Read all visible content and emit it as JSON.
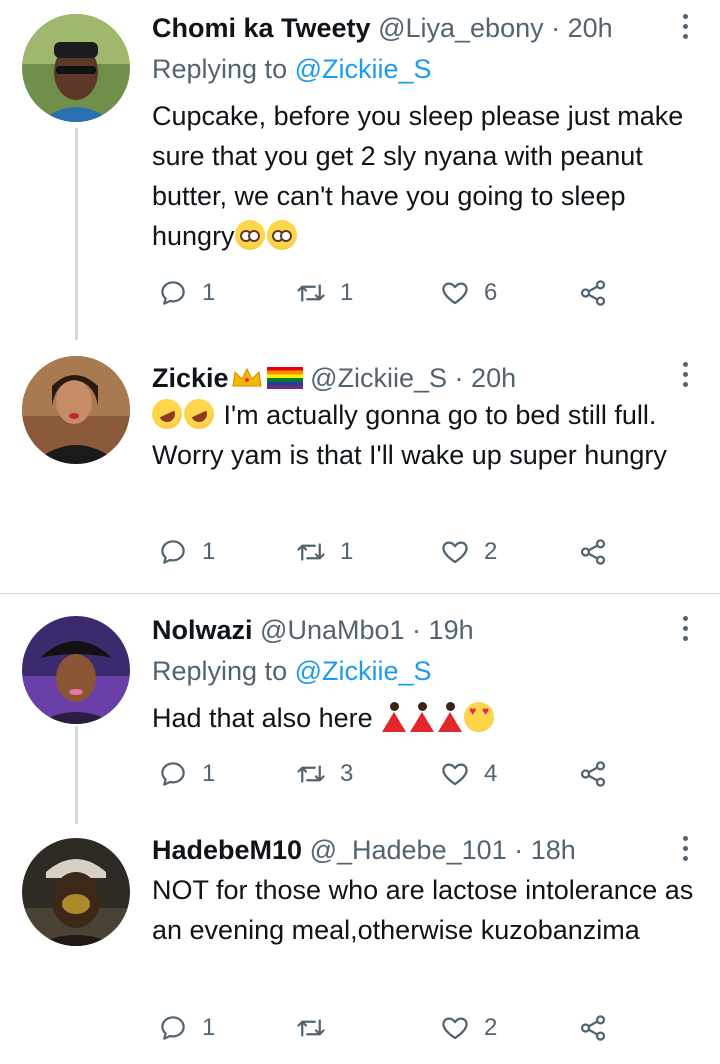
{
  "tweets": [
    {
      "name": "Chomi ka Tweety",
      "handle": "@Liya_ebony",
      "separator": "·",
      "time": "20h",
      "replying_prefix": "Replying to",
      "replying_to": "@Zickiie_S",
      "text": "Cupcake, before you sleep please just make sure that you get 2 sly nyana with peanut butter, we can't have you going to sleep hungry",
      "reply_count": "1",
      "retweet_count": "1",
      "like_count": "6"
    },
    {
      "name": "Zickie",
      "handle": "@Zickiie_S",
      "separator": "·",
      "time": "20h",
      "text": "I'm actually gonna go to bed still full. Worry yam is that I'll wake up super hungry",
      "reply_count": "1",
      "retweet_count": "1",
      "like_count": "2"
    },
    {
      "name": "Nolwazi",
      "handle": "@UnaMbo1",
      "separator": "·",
      "time": "19h",
      "replying_prefix": "Replying to",
      "replying_to": "@Zickiie_S",
      "text": "Had that also here",
      "reply_count": "1",
      "retweet_count": "3",
      "like_count": "4"
    },
    {
      "name": "HadebeM10",
      "handle": "@_Hadebe_101",
      "separator": "·",
      "time": "18h",
      "text": "NOT for those who are lactose intolerance as an evening meal,otherwise kuzobanzima",
      "reply_count": "1",
      "retweet_count": "",
      "like_count": "2"
    }
  ],
  "colors": {
    "text": "#0f1419",
    "secondary": "#536471",
    "link": "#1d9bf0",
    "line": "#cfd9de"
  },
  "icons": [
    "reply-icon",
    "retweet-icon",
    "like-icon",
    "share-icon",
    "more-icon"
  ]
}
